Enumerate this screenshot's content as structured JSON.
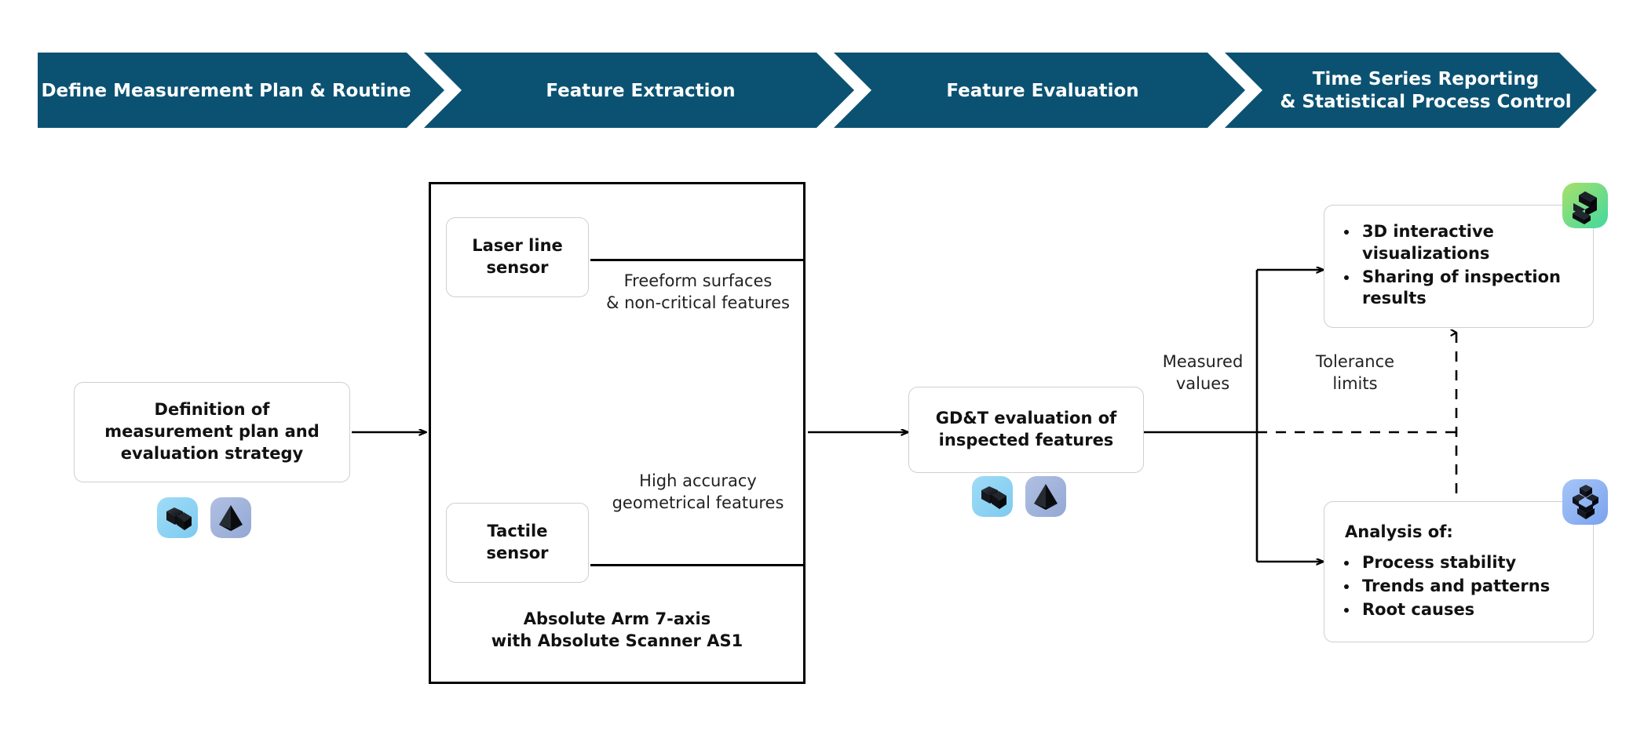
{
  "colors": {
    "banner_blue": "#0b5272",
    "page_bg": "#ffffff",
    "line": "#000000",
    "box_border": "#cfcfcf",
    "icon_cube_blue": "#8fd4f2",
    "icon_pyramid_periwinkle": "#9fb2d9",
    "icon_green": "#7fd98a",
    "icon_blue": "#8fb4f0"
  },
  "banner": {
    "stages": [
      {
        "id": "stage-1",
        "label": "Define Measurement Plan & Routine"
      },
      {
        "id": "stage-2",
        "label": "Feature Extraction"
      },
      {
        "id": "stage-3",
        "label": "Feature Evaluation"
      },
      {
        "id": "stage-4",
        "label": "Time Series Reporting\n& Statistical Process Control"
      }
    ]
  },
  "flow": {
    "definition_box": {
      "text": "Definition of\nmeasurement plan and\nevaluation strategy",
      "icons": [
        "cube-icon",
        "pyramid-icon"
      ]
    },
    "feature_extraction": {
      "outer_label": "Absolute Arm 7-axis\nwith Absolute Scanner AS1",
      "laser_sensor": "Laser line\nsensor",
      "tactile_sensor": "Tactile\nsensor",
      "laser_output": "Freeform surfaces\n& non-critical features",
      "tactile_output": "High accuracy\ngeometrical features"
    },
    "gdt_box": {
      "text": "GD&T evaluation of\ninspected features",
      "icons": [
        "cube-icon",
        "pyramid-icon"
      ]
    },
    "edge_labels": {
      "measured_values": "Measured\nvalues",
      "tolerance_limits": "Tolerance\nlimits"
    },
    "reporting_box": {
      "items": [
        "3D interactive visualizations",
        "Sharing of inspection results"
      ],
      "icon": "green-blocks-icon"
    },
    "analysis_box": {
      "heading": "Analysis of:",
      "items": [
        "Process stability",
        "Trends and patterns",
        "Root causes"
      ],
      "icon": "blue-download-blocks-icon"
    }
  }
}
